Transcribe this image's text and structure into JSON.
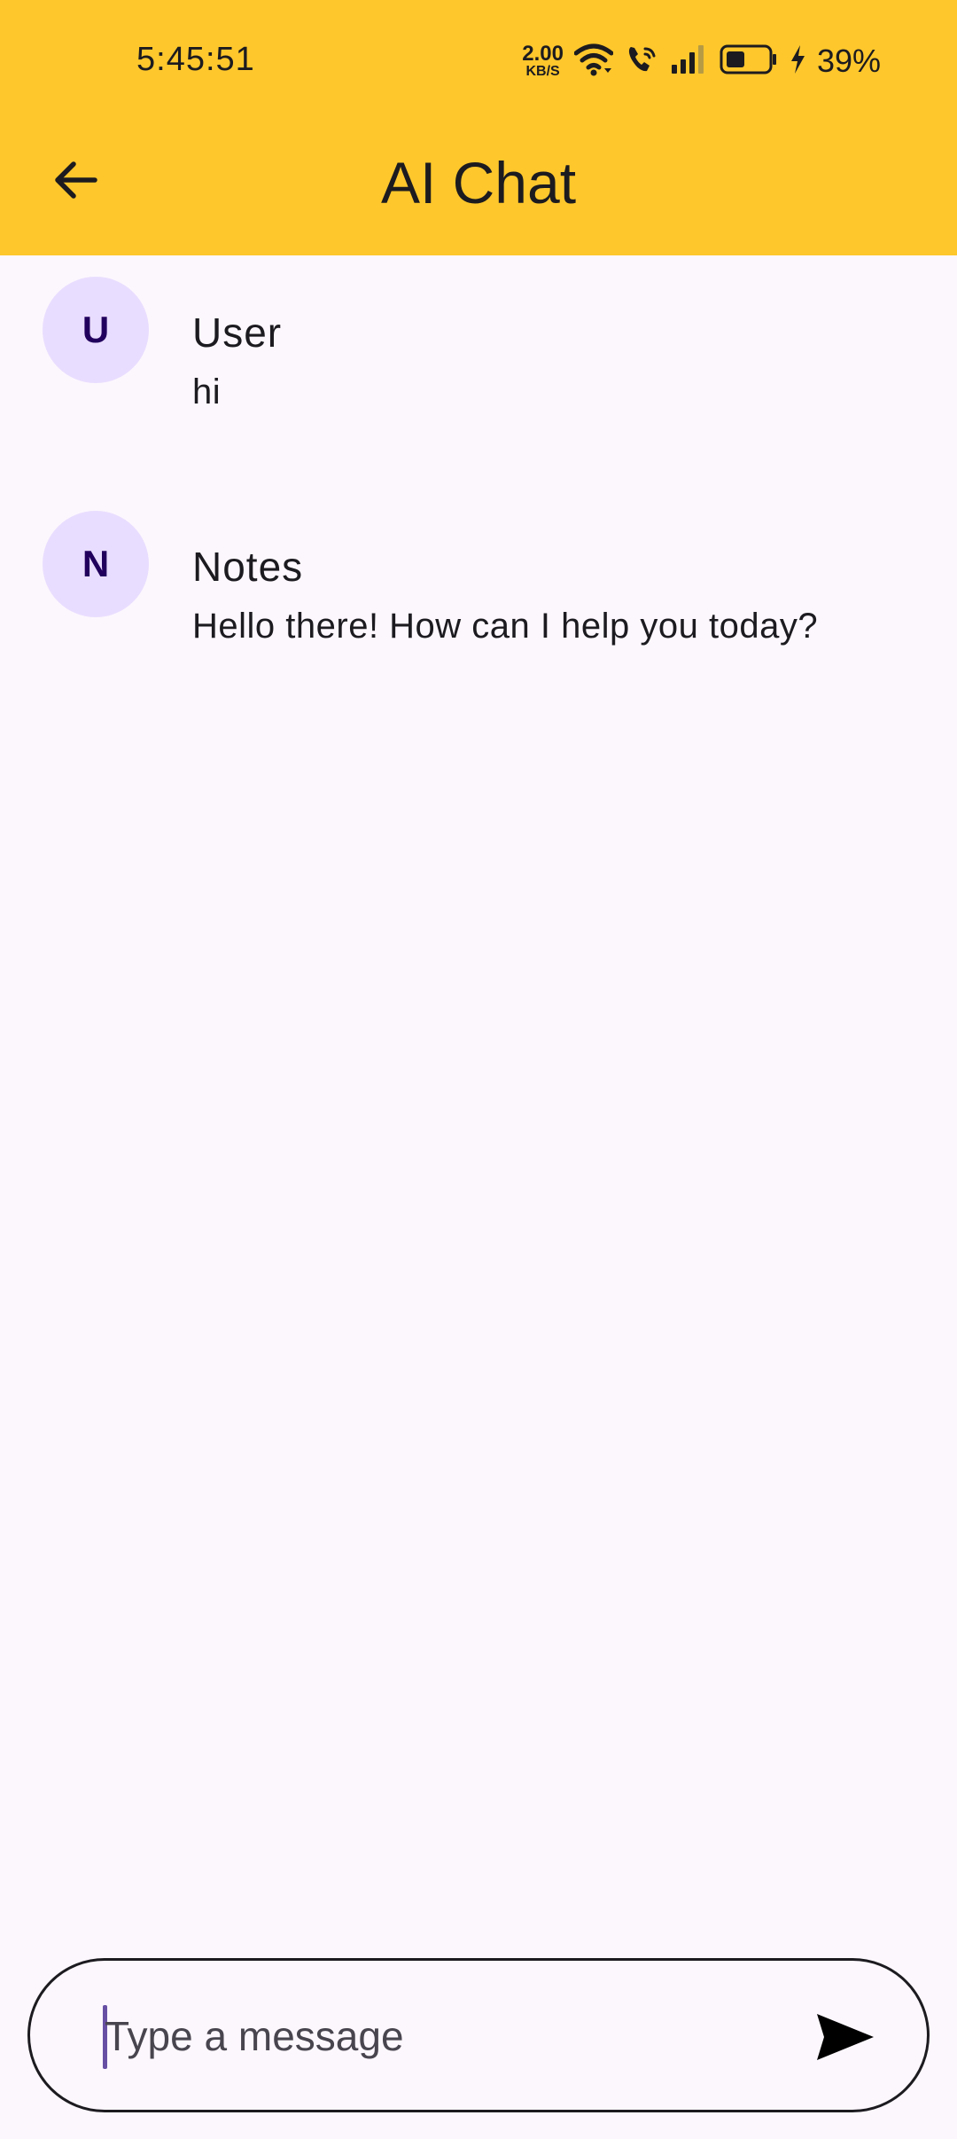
{
  "status_bar": {
    "time": "5:45:51",
    "net_speed_value": "2.00",
    "net_speed_unit": "KB/S",
    "battery_percent": "39%",
    "icons": [
      "wifi-icon",
      "wifi-calling-icon",
      "cellular-signal-icon",
      "battery-icon",
      "charging-bolt-icon"
    ]
  },
  "app_bar": {
    "title": "AI Chat",
    "back_icon": "arrow-back-icon",
    "background_color": "#fec72c"
  },
  "messages": [
    {
      "avatar_initial": "U",
      "sender": "User",
      "text": "hi"
    },
    {
      "avatar_initial": "N",
      "sender": "Notes",
      "text": "Hello there! How can I help you today?"
    }
  ],
  "composer": {
    "placeholder": "Type a message",
    "value": "",
    "send_icon": "send-icon"
  },
  "colors": {
    "background": "#fcf7fd",
    "avatar_bg": "#e9ddff",
    "avatar_text": "#21005d",
    "accent_cursor": "#6750a4"
  }
}
